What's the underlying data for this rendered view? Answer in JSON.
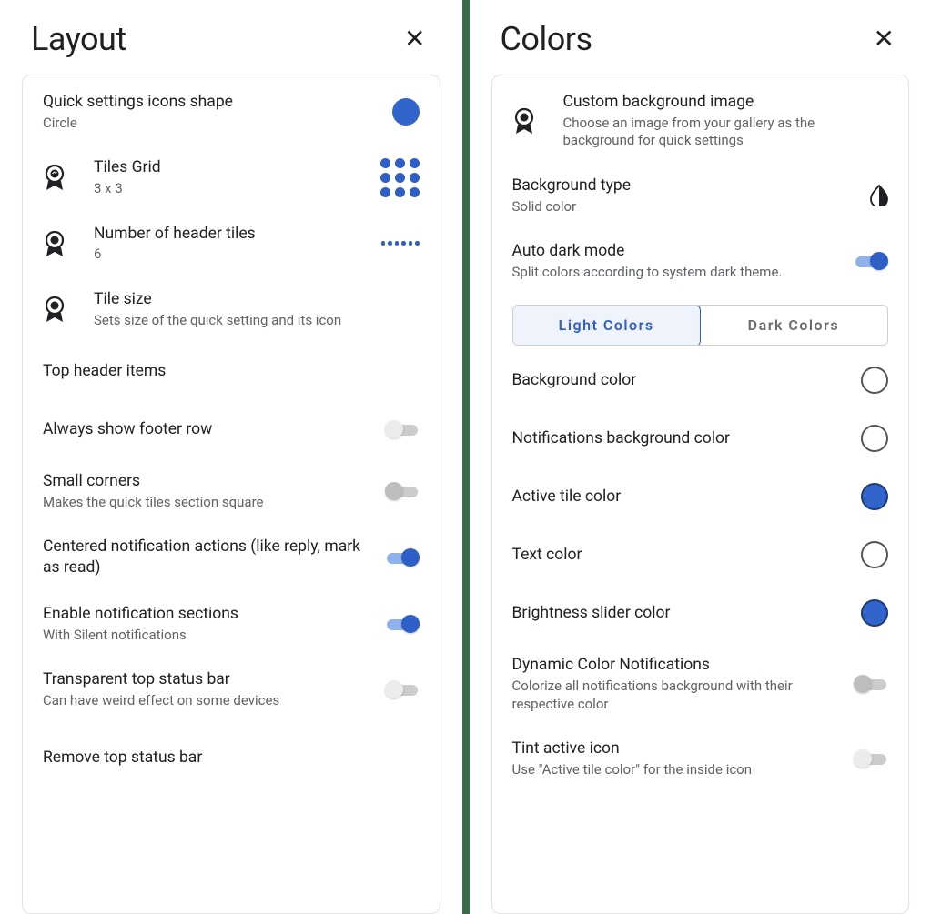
{
  "layout": {
    "title": "Layout",
    "items": {
      "icons_shape": {
        "label": "Quick settings icons shape",
        "sub": "Circle"
      },
      "tiles_grid": {
        "label": "Tiles Grid",
        "sub": "3 x 3"
      },
      "header_tiles": {
        "label": "Number of header tiles",
        "sub": "6"
      },
      "tile_size": {
        "label": "Tile size",
        "sub": "Sets size of the quick setting and its icon"
      },
      "top_header_items": {
        "label": "Top header items"
      },
      "footer_row": {
        "label": "Always show footer row",
        "on": false
      },
      "small_corners": {
        "label": "Small corners",
        "sub": "Makes the quick tiles section square",
        "on": false
      },
      "centered_notif": {
        "label": "Centered notification actions (like reply, mark as read)",
        "on": true
      },
      "notif_sections": {
        "label": "Enable notification sections",
        "sub": "With Silent notifications",
        "on": true
      },
      "transparent_status": {
        "label": "Transparent top status bar",
        "sub": "Can have weird effect on some devices",
        "on": false
      },
      "remove_status": {
        "label": "Remove top status bar"
      }
    }
  },
  "colors": {
    "title": "Colors",
    "accent": "#3265cc",
    "items": {
      "custom_bg": {
        "label": "Custom background image",
        "sub": "Choose an image from your gallery as the background for quick settings"
      },
      "bg_type": {
        "label": "Background type",
        "sub": "Solid color"
      },
      "auto_dark": {
        "label": "Auto dark mode",
        "sub": "Split colors according to system dark theme.",
        "on": true
      },
      "seg_light": "Light Colors",
      "seg_dark": "Dark Colors",
      "bg_color": {
        "label": "Background color",
        "color": "#ffffff",
        "filled": false
      },
      "notif_bg": {
        "label": "Notifications background color",
        "color": "#ffffff",
        "filled": false
      },
      "active_tile": {
        "label": "Active tile color",
        "color": "#3265cc",
        "filled": true
      },
      "text_color": {
        "label": "Text color",
        "color": "#ffffff",
        "filled": false
      },
      "brightness": {
        "label": "Brightness slider color",
        "color": "#3265cc",
        "filled": true
      },
      "dynamic_notif": {
        "label": "Dynamic Color Notifications",
        "sub": "Colorize all notifications background with their respective color",
        "on": false
      },
      "tint_icon": {
        "label": "Tint active icon",
        "sub": "Use \"Active tile color\" for the inside icon",
        "on": false
      }
    }
  }
}
